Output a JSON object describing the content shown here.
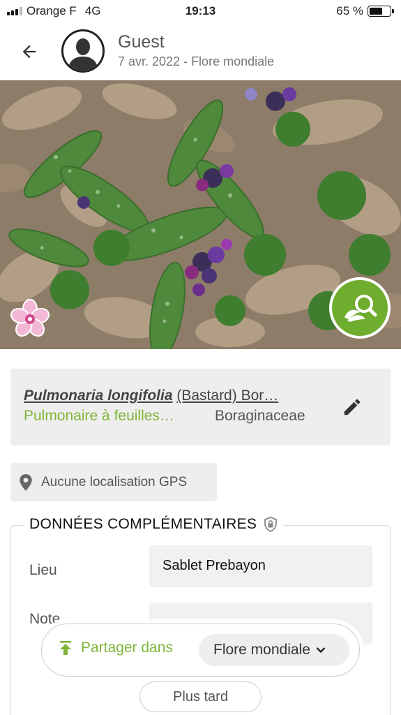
{
  "status_bar": {
    "carrier": "Orange F",
    "network": "4G",
    "time": "19:13",
    "battery_percent": "65 %",
    "battery_level": 0.65
  },
  "header": {
    "back_icon": "arrow-left-icon",
    "avatar_icon": "person-silhouette-icon",
    "user_name": "Guest",
    "subtitle": "7 avr. 2022 - Flore mondiale"
  },
  "photo": {
    "badge_icon": "pink-flower-icon",
    "identify_icon": "plant-search-icon",
    "identify_color": "#6fad2f"
  },
  "species": {
    "scientific_name": "Pulmonaria longifolia",
    "author": "(Bastard) Bor…",
    "common_name": "Pulmonaire à feuilles…",
    "family": "Boraginaceae",
    "edit_icon": "pencil-icon"
  },
  "gps": {
    "icon": "location-pin-icon",
    "label": "Aucune localisation GPS"
  },
  "extra": {
    "title": "DONNÉES COMPLÉMENTAIRES",
    "title_icon": "shield-lock-icon",
    "rows": [
      {
        "label": "Lieu",
        "value": "Sablet Prebayon"
      },
      {
        "label": "Note",
        "value": ""
      }
    ]
  },
  "actions": {
    "share_label": "Partager dans",
    "share_icon": "upload-arrow-icon",
    "destination": "Flore mondiale",
    "dropdown_icon": "chevron-down-icon",
    "later_label": "Plus tard"
  },
  "colors": {
    "accent_green": "#7fb53a",
    "card_grey": "#eeeeee"
  }
}
